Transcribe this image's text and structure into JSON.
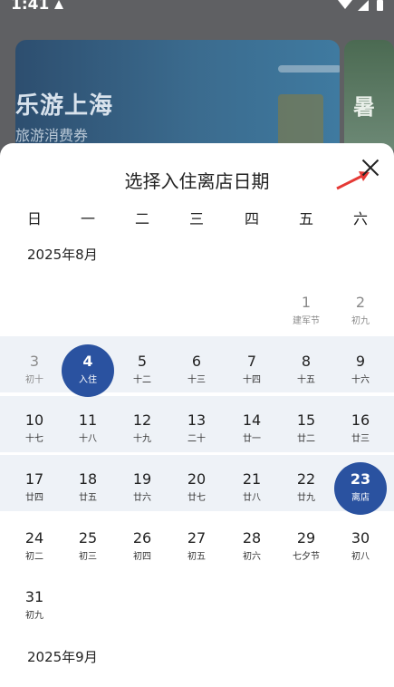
{
  "status": {
    "time": "1:41"
  },
  "background": {
    "banner_title": "乐游上海",
    "banner_subtitle": "旅游消费券",
    "banner2_text": "暑"
  },
  "sheet": {
    "title": "选择入住离店日期",
    "weekdays": [
      "日",
      "一",
      "二",
      "三",
      "四",
      "五",
      "六"
    ],
    "months": [
      {
        "label": "2025年8月",
        "days": [
          {
            "num": "1",
            "lunar": "建军节",
            "col": 5,
            "row": 0,
            "gray": true
          },
          {
            "num": "2",
            "lunar": "初九",
            "col": 6,
            "row": 0,
            "gray": true
          },
          {
            "num": "3",
            "lunar": "初十",
            "col": 0,
            "row": 1,
            "gray": true
          },
          {
            "num": "4",
            "lunar": "入住",
            "col": 1,
            "row": 1,
            "selected": true
          },
          {
            "num": "5",
            "lunar": "十二",
            "col": 2,
            "row": 1
          },
          {
            "num": "6",
            "lunar": "十三",
            "col": 3,
            "row": 1
          },
          {
            "num": "7",
            "lunar": "十四",
            "col": 4,
            "row": 1
          },
          {
            "num": "8",
            "lunar": "十五",
            "col": 5,
            "row": 1
          },
          {
            "num": "9",
            "lunar": "十六",
            "col": 6,
            "row": 1
          },
          {
            "num": "10",
            "lunar": "十七",
            "col": 0,
            "row": 2
          },
          {
            "num": "11",
            "lunar": "十八",
            "col": 1,
            "row": 2
          },
          {
            "num": "12",
            "lunar": "十九",
            "col": 2,
            "row": 2
          },
          {
            "num": "13",
            "lunar": "二十",
            "col": 3,
            "row": 2
          },
          {
            "num": "14",
            "lunar": "廿一",
            "col": 4,
            "row": 2
          },
          {
            "num": "15",
            "lunar": "廿二",
            "col": 5,
            "row": 2
          },
          {
            "num": "16",
            "lunar": "廿三",
            "col": 6,
            "row": 2
          },
          {
            "num": "17",
            "lunar": "廿四",
            "col": 0,
            "row": 3
          },
          {
            "num": "18",
            "lunar": "廿五",
            "col": 1,
            "row": 3
          },
          {
            "num": "19",
            "lunar": "廿六",
            "col": 2,
            "row": 3
          },
          {
            "num": "20",
            "lunar": "廿七",
            "col": 3,
            "row": 3
          },
          {
            "num": "21",
            "lunar": "廿八",
            "col": 4,
            "row": 3
          },
          {
            "num": "22",
            "lunar": "廿九",
            "col": 5,
            "row": 3
          },
          {
            "num": "23",
            "lunar": "离店",
            "col": 6,
            "row": 3,
            "selected": true
          },
          {
            "num": "24",
            "lunar": "初二",
            "col": 0,
            "row": 4
          },
          {
            "num": "25",
            "lunar": "初三",
            "col": 1,
            "row": 4
          },
          {
            "num": "26",
            "lunar": "初四",
            "col": 2,
            "row": 4
          },
          {
            "num": "27",
            "lunar": "初五",
            "col": 3,
            "row": 4
          },
          {
            "num": "28",
            "lunar": "初六",
            "col": 4,
            "row": 4
          },
          {
            "num": "29",
            "lunar": "七夕节",
            "col": 5,
            "row": 4
          },
          {
            "num": "30",
            "lunar": "初八",
            "col": 6,
            "row": 4
          },
          {
            "num": "31",
            "lunar": "初九",
            "col": 0,
            "row": 5
          }
        ]
      },
      {
        "label": "2025年9月"
      }
    ]
  },
  "colors": {
    "accent": "#2a52a0",
    "range_band": "#eef2f7",
    "annotation_arrow": "#e53935"
  },
  "icons": {
    "close": "close-icon",
    "annotation": "red-arrow-icon"
  }
}
